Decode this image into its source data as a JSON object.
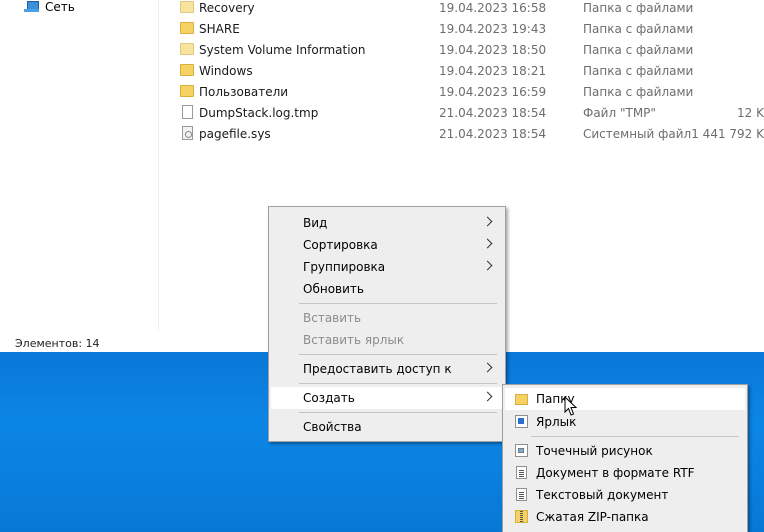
{
  "nav": {
    "network_label": "Сеть"
  },
  "files": [
    {
      "name": "Recovery",
      "date": "19.04.2023 16:58",
      "type": "Папка с файлами",
      "size": "",
      "icon": "folder-light"
    },
    {
      "name": "SHARE",
      "date": "19.04.2023 19:43",
      "type": "Папка с файлами",
      "size": "",
      "icon": "folder"
    },
    {
      "name": "System Volume Information",
      "date": "19.04.2023 18:50",
      "type": "Папка с файлами",
      "size": "",
      "icon": "folder-light"
    },
    {
      "name": "Windows",
      "date": "19.04.2023 18:21",
      "type": "Папка с файлами",
      "size": "",
      "icon": "folder"
    },
    {
      "name": "Пользователи",
      "date": "19.04.2023 16:59",
      "type": "Папка с файлами",
      "size": "",
      "icon": "folder"
    },
    {
      "name": "DumpStack.log.tmp",
      "date": "21.04.2023 18:54",
      "type": "Файл \"TMP\"",
      "size": "12 K",
      "icon": "file"
    },
    {
      "name": "pagefile.sys",
      "date": "21.04.2023 18:54",
      "type": "Системный файл",
      "size": "1 441 792 K",
      "icon": "system-file"
    }
  ],
  "status": {
    "items_count": "Элементов: 14"
  },
  "context_menu": {
    "view": "Вид",
    "sort": "Сортировка",
    "group": "Группировка",
    "refresh": "Обновить",
    "paste": "Вставить",
    "paste_shortcut": "Вставить ярлык",
    "share_access": "Предоставить доступ к",
    "create": "Создать",
    "properties": "Свойства"
  },
  "create_submenu": {
    "folder": "Папку",
    "shortcut": "Ярлык",
    "bitmap": "Точечный рисунок",
    "rtf": "Документ в формате RTF",
    "text": "Текстовый документ",
    "zip": "Сжатая ZIP-папка"
  },
  "colors": {
    "highlight": "#ffffff",
    "menu_bg": "#eeeeee",
    "desktop": "#0a78d8",
    "folder": "#f6d264"
  }
}
